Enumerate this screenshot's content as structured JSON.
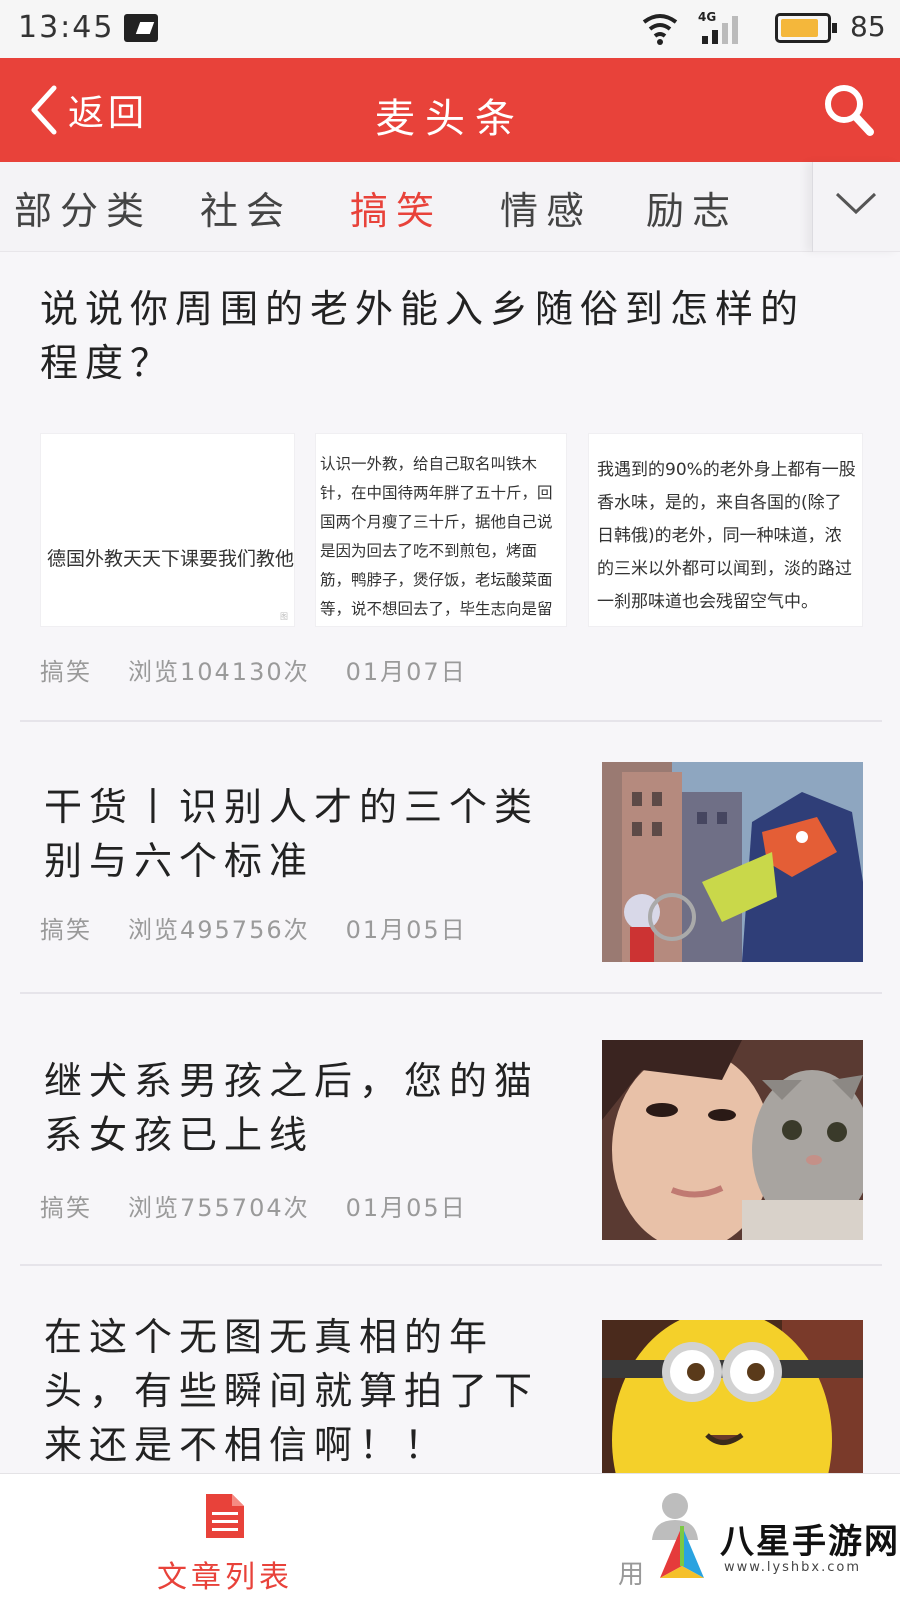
{
  "status_bar": {
    "time": "13:45",
    "network": "4G",
    "battery_level": 85,
    "battery_text": "85"
  },
  "header": {
    "back_label": "返回",
    "title": "麦头条",
    "bg_color": "#e8423a"
  },
  "categories": {
    "tabs": [
      "部分类",
      "社会",
      "搞笑",
      "情感",
      "励志"
    ],
    "active_index": 2,
    "more_icon": "chevron-down-icon"
  },
  "articles": [
    {
      "title": "说说你周围的老外能入乡随俗到怎样的程度？",
      "thumb_texts": [
        "德国外教天天下课要我们教他打麻将😂",
        "认识一外教，给自己取名叫铁木针，在中国待两年胖了五十斤，回国两个月瘦了三十斤，据他自己说是因为回去了吃不到煎包，烤面筋，鸭脖子，煲仔饭，老坛酸菜面等，说不想回去了，毕生志向是留在中国",
        "我遇到的90%的老外身上都有一股香水味，是的，来自各国的(除了日韩俄)的老外，同一种味道，浓的三米以外都可以闻到，淡的路过一刹那味道也会残留空气中。"
      ],
      "category": "搞笑",
      "views": "浏览104130次",
      "date": "01月07日"
    },
    {
      "title": "干货丨识别人才的三个类别与六个标准",
      "category": "搞笑",
      "views": "浏览495756次",
      "date": "01月05日",
      "image": "cartoon-monster-image"
    },
    {
      "title": "继犬系男孩之后，您的猫系女孩已上线",
      "category": "搞笑",
      "views": "浏览755704次",
      "date": "01月05日",
      "image": "girl-with-cat-image"
    },
    {
      "title": "在这个无图无真相的年头，有些瞬间就算拍了下来还是不相信啊！！",
      "image": "minion-image"
    }
  ],
  "bottom_nav": {
    "articles_label": "文章列表",
    "user_label": "用"
  },
  "watermark": {
    "text": "八星手游网",
    "url": "www.lyshbx.com"
  }
}
